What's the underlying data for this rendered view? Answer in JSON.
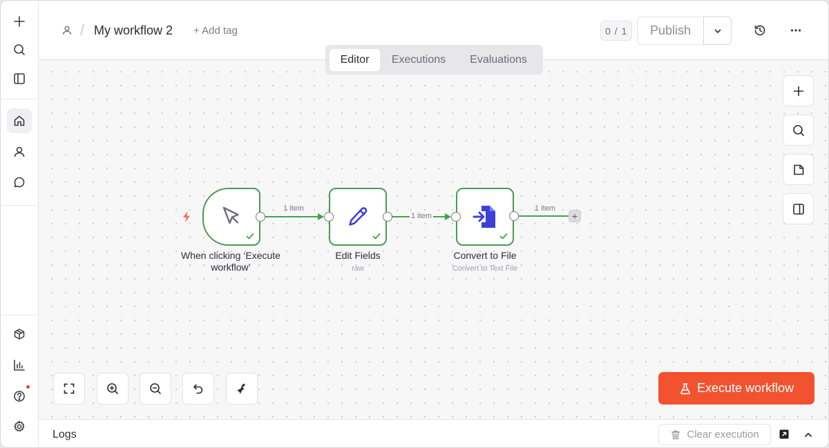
{
  "header": {
    "breadcrumb_icon": "user-icon",
    "slash": "/",
    "workflow_name": "My workflow 2",
    "add_tag": "+ Add tag",
    "version_count": "0 / 1",
    "publish_label": "Publish",
    "caret_icon": "chevron-down-icon",
    "history_icon": "history-icon",
    "more_icon": "more-horizontal-icon"
  },
  "tabs": [
    {
      "label": "Editor",
      "active": true
    },
    {
      "label": "Executions",
      "active": false
    },
    {
      "label": "Evaluations",
      "active": false
    }
  ],
  "sidebar": {
    "top": [
      "plus-icon",
      "search-icon",
      "sidebar-toggle-icon"
    ],
    "nav": [
      "home-icon",
      "user-icon",
      "chat-icon"
    ],
    "bottom": [
      "templates-icon",
      "insights-icon",
      "help-icon",
      "settings-icon"
    ]
  },
  "workflow": {
    "nodes": [
      {
        "id": "trigger",
        "title": "When clicking ‘Execute workflow’",
        "subtitle": "",
        "icon": "cursor-icon",
        "status": "success"
      },
      {
        "id": "edit",
        "title": "Edit Fields",
        "subtitle": "raw",
        "icon": "pencil-icon",
        "status": "success"
      },
      {
        "id": "convert",
        "title": "Convert to File",
        "subtitle": "Convert to Text File",
        "icon": "file-import-icon",
        "status": "success"
      }
    ],
    "edges": [
      {
        "from": "trigger",
        "to": "edit",
        "label": "1 item"
      },
      {
        "from": "edit",
        "to": "convert",
        "label": "1 item"
      },
      {
        "from": "convert",
        "to": "",
        "label": "1 item"
      }
    ],
    "add_node_symbol": "+"
  },
  "canvas_tools": {
    "right": [
      "plus-icon",
      "search-icon",
      "sticky-note-icon",
      "panel-icon"
    ],
    "bottom": [
      "fit-view-icon",
      "zoom-in-icon",
      "zoom-out-icon",
      "undo-icon",
      "tidy-up-icon"
    ]
  },
  "execute_button": {
    "label": "Execute workflow",
    "icon": "flask-icon"
  },
  "logs": {
    "title": "Logs",
    "clear_label": "Clear execution",
    "popout_icon": "popout-icon",
    "collapse_icon": "chevron-up-icon"
  },
  "colors": {
    "accent": "#f2522f",
    "node_border": "#4a9a53",
    "edge": "#3fa34d",
    "node_icon_blue": "#3d40d6"
  }
}
